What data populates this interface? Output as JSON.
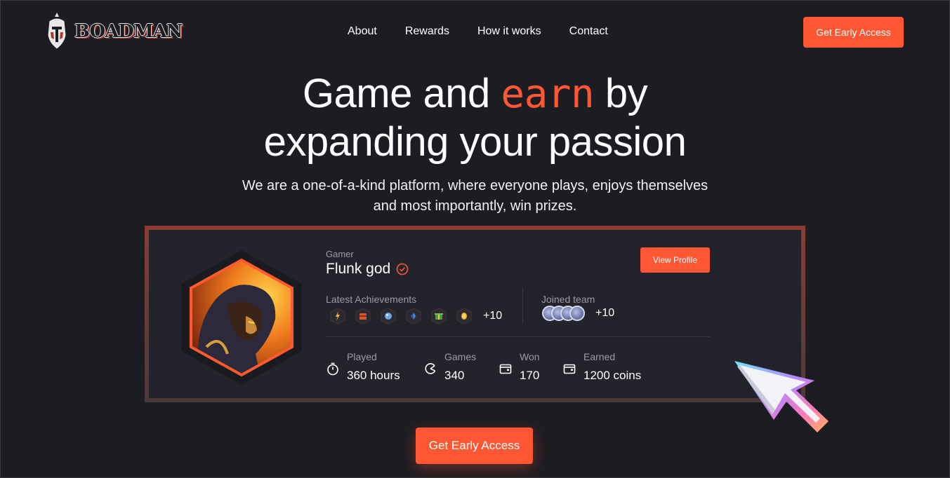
{
  "brand": {
    "name": "BOADMAN",
    "accent_color": "#ff5733",
    "background": "#1c1d22"
  },
  "nav": {
    "items": [
      "About",
      "Rewards",
      "How it works",
      "Contact"
    ]
  },
  "header": {
    "cta_label": "Get Early Access"
  },
  "hero": {
    "title_before": "Game and ",
    "title_accent": "earn",
    "title_after": " by",
    "title_line2": "expanding your passion",
    "subtitle_line1": "We are a one-of-a-kind platform, where everyone plays, enjoys themselves",
    "subtitle_line2": "and most importantly, win prizes."
  },
  "profile": {
    "role_label": "Gamer",
    "name": "Flunk god",
    "view_profile_label": "View Profile",
    "achievements_label": "Latest Achievements",
    "achievements_more": "+10",
    "team_label": "Joined team",
    "team_more": "+10",
    "stats": [
      {
        "label": "Played",
        "value": "360 hours",
        "icon": "stopwatch-icon"
      },
      {
        "label": "Games",
        "value": "340",
        "icon": "pie-icon"
      },
      {
        "label": "Won",
        "value": "170",
        "icon": "wallet-icon"
      },
      {
        "label": "Earned",
        "value": "1200 coins",
        "icon": "wallet-icon"
      }
    ]
  },
  "cta": {
    "label": "Get Early Access"
  }
}
